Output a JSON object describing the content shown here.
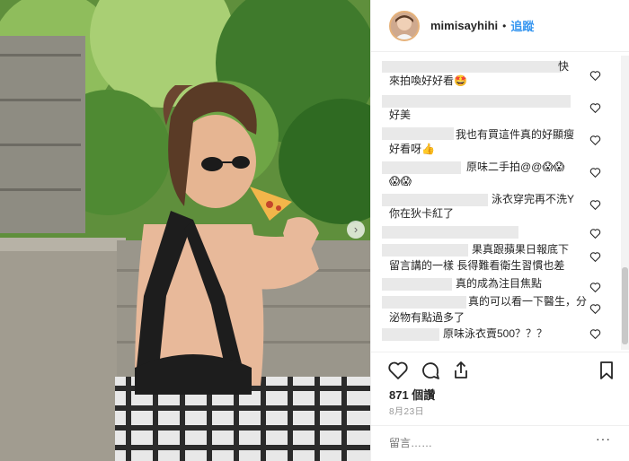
{
  "post": {
    "username": "mimisayhihi",
    "separator": "•",
    "follow_label": "追蹤",
    "likes": "871 個讚",
    "date": "8月23日",
    "comment_placeholder": "留言……",
    "more_icon": "···"
  },
  "comments": [
    {
      "text": "快",
      "note": "row-1"
    },
    {
      "text": "來拍喚好好看🤩"
    },
    {
      "text": "好美"
    },
    {
      "text": "我也有買這件真的好顯瘦"
    },
    {
      "text": "好看呀👍"
    },
    {
      "text": "原味二手拍@@😱😱"
    },
    {
      "text": "😱😱"
    },
    {
      "text": "泳衣穿完再不洗Y"
    },
    {
      "text": "你在狄卡紅了"
    },
    {
      "text": "果真跟蘋果日報底下"
    },
    {
      "text": "留言講的一樣 長得難看衛生習慣也差"
    },
    {
      "text": "真的成為注目焦點"
    },
    {
      "text": "真的可以看一下醫生，分"
    },
    {
      "text": "泌物有點過多了"
    },
    {
      "text": "原味泳衣賣500？？？"
    }
  ],
  "icons": {
    "heart": "heart-icon",
    "comment": "comment-icon",
    "share": "share-icon",
    "save": "bookmark-icon",
    "next": "chevron-right-icon"
  },
  "colors": {
    "link": "#3897f0",
    "text": "#262626",
    "muted": "#999999"
  }
}
